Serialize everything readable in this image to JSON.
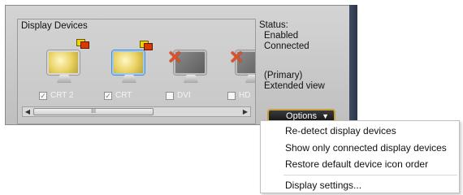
{
  "group": {
    "title": "Display Devices"
  },
  "devices": [
    {
      "label": "CRT 2",
      "checked": true
    },
    {
      "label": "CRT",
      "checked": true
    },
    {
      "label": "DVI",
      "checked": false
    },
    {
      "label": "HD",
      "checked": false
    }
  ],
  "scrollbar": {
    "left_icon": "◀",
    "right_icon": "▶",
    "grip": "III"
  },
  "status": {
    "heading": "Status:",
    "line1": "Enabled",
    "line2": "Connected"
  },
  "mode": {
    "line1": "(Primary)",
    "line2": "Extended view"
  },
  "options": {
    "label": "Options",
    "arrow": "▼"
  },
  "menu": {
    "items": [
      "Re-detect display devices",
      "Show only connected display devices",
      "Restore default device icon order",
      "Display settings..."
    ]
  },
  "colors": {
    "accent": "#c9a13a",
    "panel": "#c7c7c7",
    "button": "#151515"
  }
}
